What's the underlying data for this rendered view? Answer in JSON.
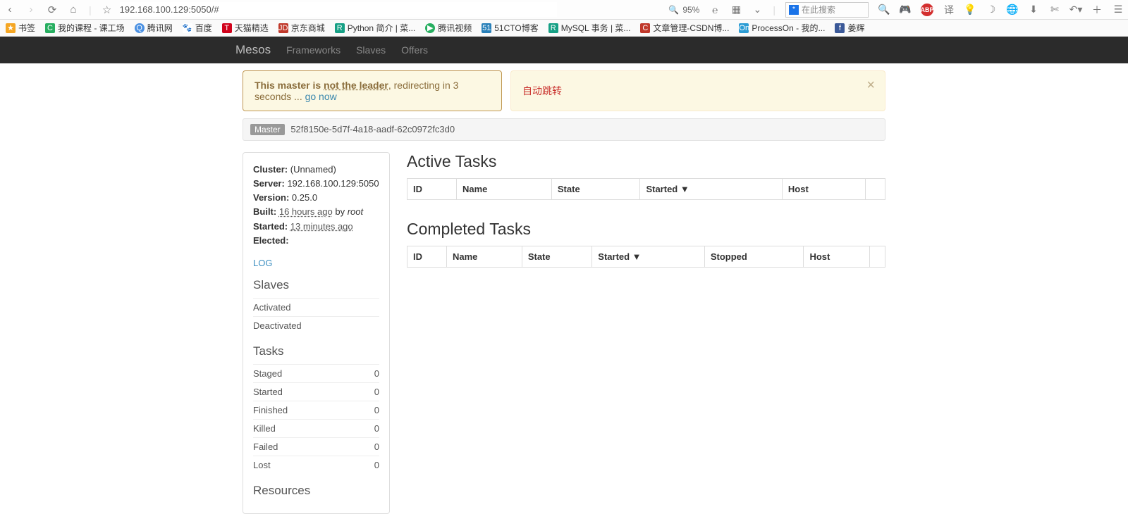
{
  "browser": {
    "url": "192.168.100.129:5050/#",
    "zoom_label": "95%",
    "search_placeholder": "在此搜索"
  },
  "bookmarks": [
    {
      "label": "书签"
    },
    {
      "label": "我的课程 - 课工场"
    },
    {
      "label": "腾讯网"
    },
    {
      "label": "百度"
    },
    {
      "label": "天猫精选"
    },
    {
      "label": "京东商城"
    },
    {
      "label": "Python 简介 | 菜..."
    },
    {
      "label": "腾讯视频"
    },
    {
      "label": "51CTO博客"
    },
    {
      "label": "MySQL 事务 | 菜..."
    },
    {
      "label": "文章管理-CSDN博..."
    },
    {
      "label": "ProcessOn - 我的..."
    },
    {
      "label": "姜辉"
    }
  ],
  "navbar": {
    "brand": "Mesos",
    "links": [
      "Frameworks",
      "Slaves",
      "Offers"
    ]
  },
  "alert_leader": {
    "prefix": "This master is ",
    "strong": "not the leader",
    "mid": ", redirecting in 3 seconds ... ",
    "link": "go now"
  },
  "auto_redirect_label": "自动跳转",
  "master_badge": "Master",
  "master_id": "52f8150e-5d7f-4a18-aadf-62c0972fc3d0",
  "info": {
    "cluster_label": "Cluster:",
    "cluster_value": "(Unnamed)",
    "server_label": "Server:",
    "server_value": "192.168.100.129:5050",
    "version_label": "Version:",
    "version_value": "0.25.0",
    "built_label": "Built:",
    "built_value": "16 hours ago",
    "built_by": " by ",
    "built_user": "root",
    "started_label": "Started:",
    "started_value": "13 minutes ago",
    "elected_label": "Elected:"
  },
  "log_label": "LOG",
  "slaves": {
    "title": "Slaves",
    "rows": [
      {
        "label": "Activated",
        "value": ""
      },
      {
        "label": "Deactivated",
        "value": ""
      }
    ]
  },
  "tasks": {
    "title": "Tasks",
    "rows": [
      {
        "label": "Staged",
        "value": "0"
      },
      {
        "label": "Started",
        "value": "0"
      },
      {
        "label": "Finished",
        "value": "0"
      },
      {
        "label": "Killed",
        "value": "0"
      },
      {
        "label": "Failed",
        "value": "0"
      },
      {
        "label": "Lost",
        "value": "0"
      }
    ]
  },
  "resources_title": "Resources",
  "active_title": "Active Tasks",
  "active_headers": [
    "ID",
    "Name",
    "State",
    "Started ▼",
    "Host"
  ],
  "completed_title": "Completed Tasks",
  "completed_headers": [
    "ID",
    "Name",
    "State",
    "Started ▼",
    "Stopped",
    "Host"
  ]
}
